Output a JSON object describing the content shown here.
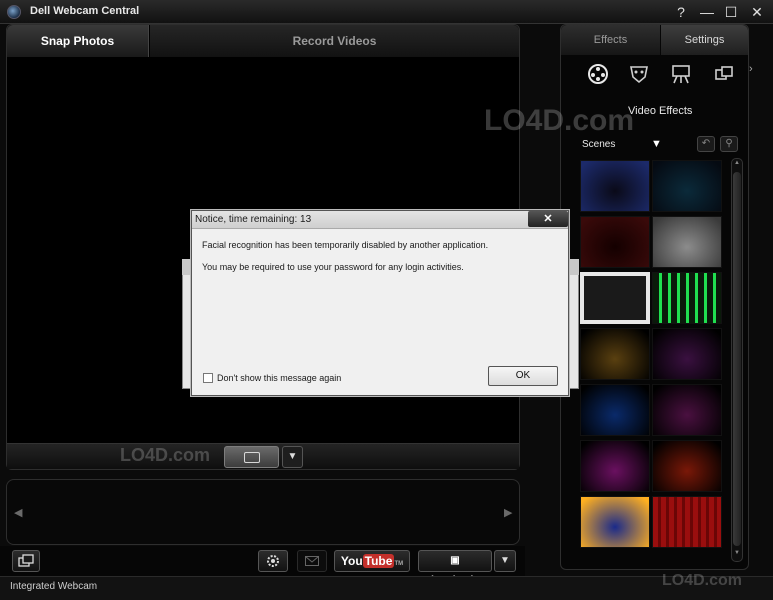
{
  "window": {
    "title": "Dell Webcam Central",
    "controls": [
      "?",
      "—",
      "☐",
      "✕"
    ]
  },
  "capture_tabs": {
    "snap": "Snap Photos",
    "record": "Record Videos"
  },
  "side_tabs": {
    "effects": "Effects",
    "settings": "Settings"
  },
  "effects": {
    "section_title": "Video Effects",
    "category": "Scenes",
    "dropdown_glyph": "▼",
    "more_glyph": "›",
    "icons": [
      "effects-reel-icon",
      "avatar-mask-icon",
      "scene-easel-icon",
      "overlay-frames-icon"
    ],
    "undo_glyph": "↶",
    "pin_glyph": "⚲",
    "scenes": [
      {
        "name": "party",
        "colors": [
          "#0a0a18",
          "#1c2a6a"
        ]
      },
      {
        "name": "city-night",
        "colors": [
          "#0b2a3a",
          "#050a12"
        ]
      },
      {
        "name": "party-lights",
        "colors": [
          "#140000",
          "#3a0a0a"
        ]
      },
      {
        "name": "theater-curtain",
        "colors": [
          "#8c8c8c",
          "#3a3a3a"
        ]
      },
      {
        "name": "photo-frame",
        "colors": [
          "#f4f4f4",
          "#aaaaaa"
        ]
      },
      {
        "name": "neon-bars",
        "colors": [
          "#0a3a0a",
          "#20ff60"
        ]
      },
      {
        "name": "gold-glow",
        "colors": [
          "#5a4010",
          "#000000"
        ]
      },
      {
        "name": "moon-stage",
        "colors": [
          "#3a1040",
          "#000000"
        ]
      },
      {
        "name": "blue-stage",
        "colors": [
          "#0a2a6a",
          "#000000"
        ]
      },
      {
        "name": "purple-stage",
        "colors": [
          "#4a1040",
          "#000000"
        ]
      },
      {
        "name": "pink-night",
        "colors": [
          "#6a1060",
          "#000000"
        ]
      },
      {
        "name": "red-city",
        "colors": [
          "#7a1808",
          "#000000"
        ]
      },
      {
        "name": "planet",
        "colors": [
          "#1a2a8a",
          "#ffb020"
        ]
      },
      {
        "name": "red-curtain-stage",
        "colors": [
          "#b01010",
          "#200000"
        ]
      }
    ]
  },
  "notice": {
    "title": "Notice, time remaining: 13",
    "close_glyph": "✕",
    "message_1": "Facial recognition has been temporarily disabled by another application.",
    "message_2": "You may be required to use your password for any login activities.",
    "checkbox_label": "Don't show this message again",
    "ok_label": "OK"
  },
  "capture": {
    "dropdown_glyph": "▼"
  },
  "gallery": {
    "prev_glyph": "◀",
    "next_glyph": "▶"
  },
  "toolbar": {
    "youtube_you": "You",
    "youtube_tube": "Tube",
    "youtube_tm": "TM",
    "photobucket_label": "photobucket",
    "share_dropdown_glyph": "▼"
  },
  "status": {
    "text": "Integrated Webcam"
  },
  "watermark": {
    "text": "LO4D.com"
  }
}
